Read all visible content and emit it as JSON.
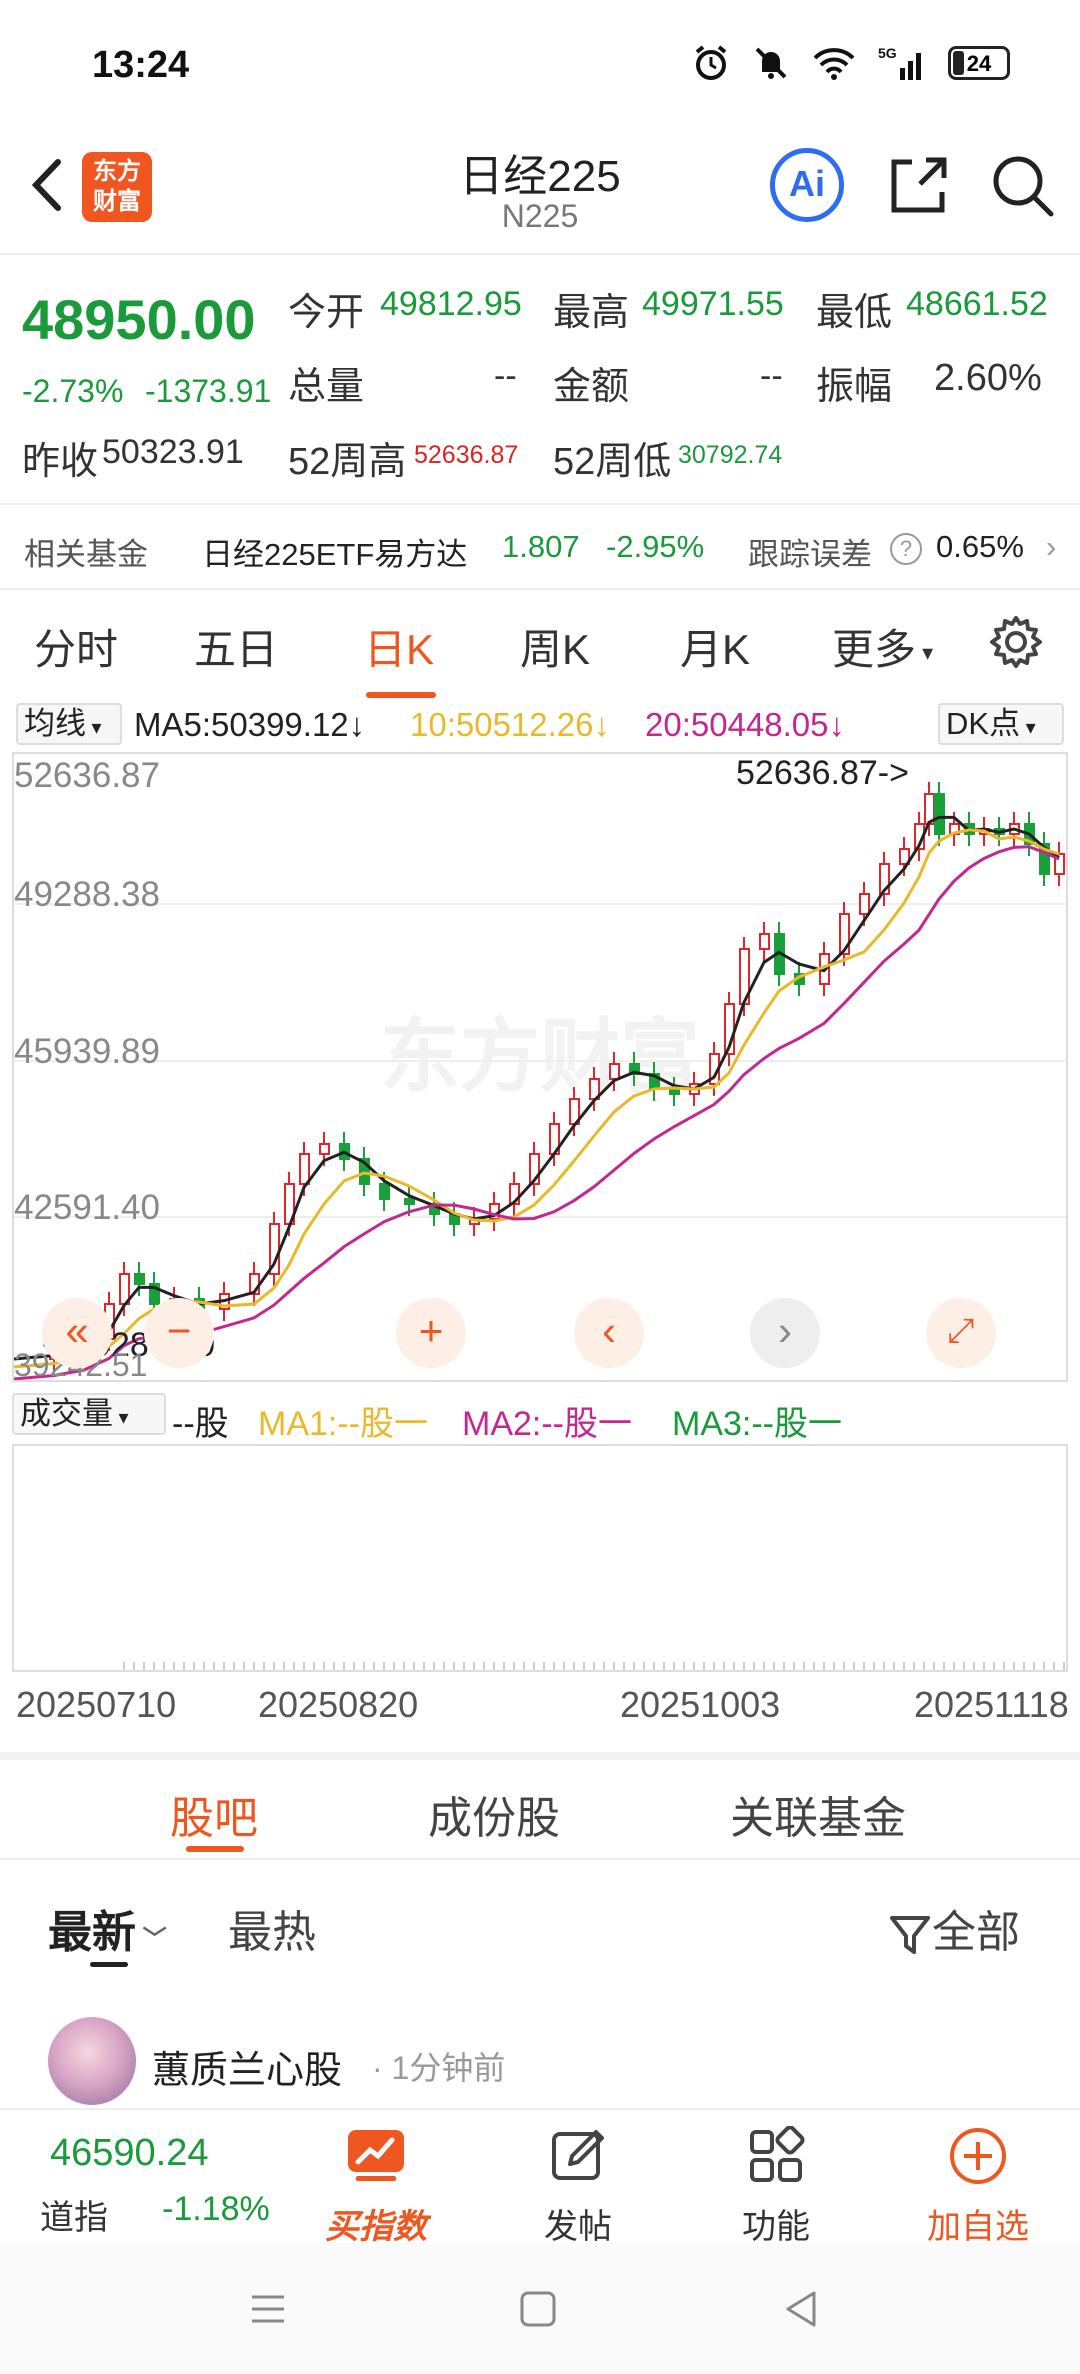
{
  "status_bar": {
    "time": "13:24",
    "battery": "24",
    "network": "5G"
  },
  "nav": {
    "logo_line1": "东方",
    "logo_line2": "财富",
    "title": "日经225",
    "subtitle": "N225",
    "ai_label": "Ai"
  },
  "quote": {
    "price": "48950.00",
    "change_pct": "-2.73%",
    "change": "-1373.91",
    "open_label": "今开",
    "open": "49812.95",
    "high_label": "最高",
    "high": "49971.55",
    "low_label": "最低",
    "low": "48661.52",
    "volume_label": "总量",
    "volume": "--",
    "amount_label": "金额",
    "amount": "--",
    "amplitude_label": "振幅",
    "amplitude": "2.60%",
    "prev_close_label": "昨收",
    "prev_close": "50323.91",
    "w52_high_label": "52周高",
    "w52_high": "52636.87",
    "w52_low_label": "52周低",
    "w52_low": "30792.74"
  },
  "fund": {
    "label": "相关基金",
    "name": "日经225ETF易方达",
    "price": "1.807",
    "pct": "-2.95%",
    "track_label": "跟踪误差",
    "track_val": "0.65%"
  },
  "tabs": {
    "t1": "分时",
    "t2": "五日",
    "t3": "日K",
    "t4": "周K",
    "t5": "月K",
    "t6": "更多"
  },
  "ma": {
    "dropdown": "均线",
    "ma5": "MA5:50399.12↓",
    "ma10": "10:50512.26↓",
    "ma20": "20:50448.05↓",
    "dk": "DK点"
  },
  "chart": {
    "y_labels": [
      "52636.87",
      "49288.38",
      "45939.89",
      "42591.40"
    ],
    "max_marker": "52636.87->",
    "min_marker": "<-39288.90",
    "bottom_partial": "39242.51",
    "watermark": "东方财富",
    "colors": {
      "up": "#e0262a",
      "down": "#19a03a",
      "ma5": "#222222",
      "ma10": "#e8b92a",
      "ma20": "#c4278f"
    }
  },
  "volume": {
    "dropdown": "成交量",
    "unit": "--股",
    "ma1": "MA1:--股一",
    "ma2": "MA2:--股一",
    "ma3": "MA3:--股一"
  },
  "dates": [
    "20250710",
    "20250820",
    "20251003",
    "20251118"
  ],
  "bottom_tabs": {
    "b1": "股吧",
    "b2": "成份股",
    "b3": "关联基金"
  },
  "filter": {
    "latest": "最新",
    "hot": "最热",
    "all": "全部"
  },
  "post": {
    "user": "蕙质兰心股",
    "time": "· 1分钟前"
  },
  "bottom_bar": {
    "dji_val": "46590.24",
    "dji_name": "道指",
    "dji_pct": "-1.18%",
    "buy": "买指数",
    "post": "发帖",
    "func": "功能",
    "add": "加自选"
  }
}
